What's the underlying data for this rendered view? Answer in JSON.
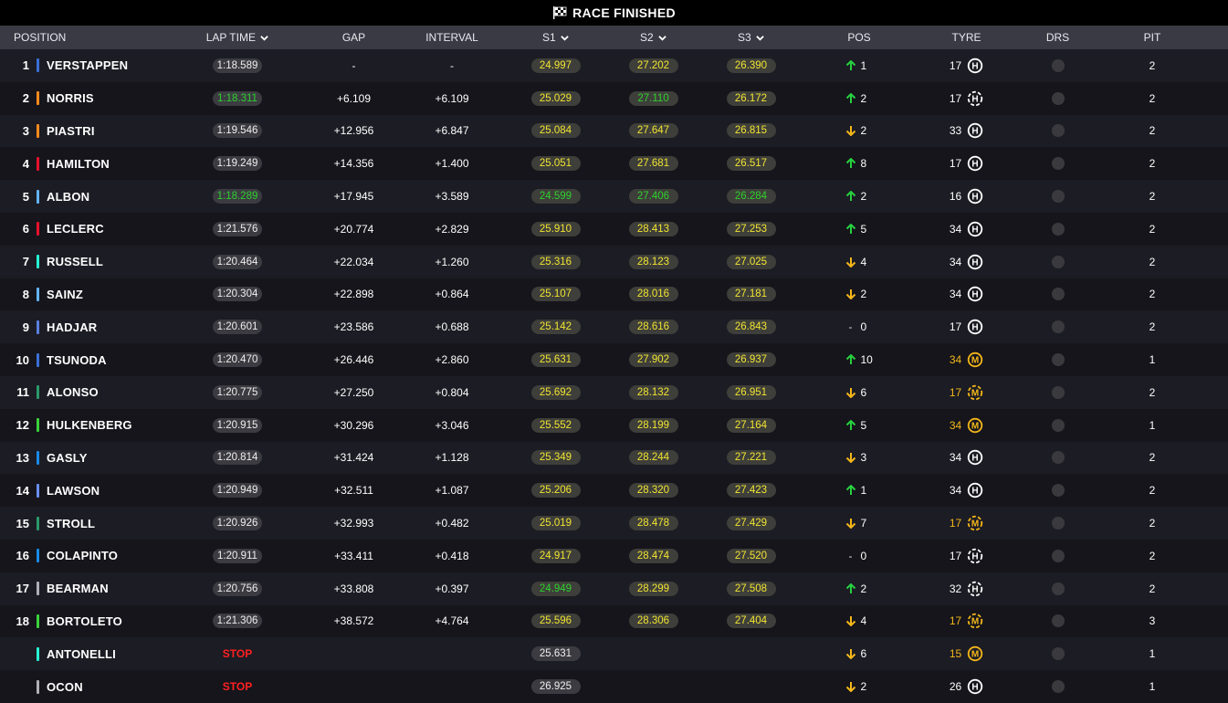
{
  "title": "RACE FINISHED",
  "flag_icon": "chequered-flag-icon",
  "colors": {
    "green": "#2ed22e",
    "sector_yellow": "#f1e531",
    "stop_red": "#ff2020",
    "up_green": "#27d13f",
    "down_amber": "#f4b71a"
  },
  "headers": {
    "position": "POSITION",
    "lap_time": "LAP TIME",
    "gap": "GAP",
    "interval": "INTERVAL",
    "s1": "S1",
    "s2": "S2",
    "s3": "S3",
    "pos": "POS",
    "tyre": "TYRE",
    "drs": "DRS",
    "pit": "PIT"
  },
  "rows": [
    {
      "pos": "1",
      "name": "VERSTAPPEN",
      "team_color": "#3a6fd8",
      "lap": "1:18.589",
      "lap_green": false,
      "gap": "-",
      "interval": "-",
      "s1": "24.997",
      "s1c": "y",
      "s2": "27.202",
      "s2c": "y",
      "s3": "26.390",
      "s3c": "y",
      "dir": "up",
      "change": "1",
      "tyre_age": "17",
      "tyre": "H",
      "tyre_yellow": false,
      "pit": "2"
    },
    {
      "pos": "2",
      "name": "NORRIS",
      "team_color": "#ff8a1c",
      "lap": "1:18.311",
      "lap_green": true,
      "gap": "+6.109",
      "interval": "+6.109",
      "s1": "25.029",
      "s1c": "y",
      "s2": "27.110",
      "s2c": "g",
      "s3": "26.172",
      "s3c": "y",
      "dir": "up",
      "change": "2",
      "tyre_age": "17",
      "tyre": "H",
      "tyre_yellow": false,
      "tyre_dashed": true,
      "pit": "2"
    },
    {
      "pos": "3",
      "name": "PIASTRI",
      "team_color": "#ff8a1c",
      "lap": "1:19.546",
      "lap_green": false,
      "gap": "+12.956",
      "interval": "+6.847",
      "s1": "25.084",
      "s1c": "y",
      "s2": "27.647",
      "s2c": "y",
      "s3": "26.815",
      "s3c": "y",
      "dir": "down",
      "change": "2",
      "tyre_age": "33",
      "tyre": "H",
      "tyre_yellow": false,
      "pit": "2"
    },
    {
      "pos": "4",
      "name": "HAMILTON",
      "team_color": "#e8102d",
      "lap": "1:19.249",
      "lap_green": false,
      "gap": "+14.356",
      "interval": "+1.400",
      "s1": "25.051",
      "s1c": "y",
      "s2": "27.681",
      "s2c": "y",
      "s3": "26.517",
      "s3c": "y",
      "dir": "up",
      "change": "8",
      "tyre_age": "17",
      "tyre": "H",
      "tyre_yellow": false,
      "pit": "2"
    },
    {
      "pos": "5",
      "name": "ALBON",
      "team_color": "#64b4ff",
      "lap": "1:18.289",
      "lap_green": true,
      "gap": "+17.945",
      "interval": "+3.589",
      "s1": "24.599",
      "s1c": "g",
      "s2": "27.406",
      "s2c": "g",
      "s3": "26.284",
      "s3c": "g",
      "dir": "up",
      "change": "2",
      "tyre_age": "16",
      "tyre": "H",
      "tyre_yellow": false,
      "pit": "2"
    },
    {
      "pos": "6",
      "name": "LECLERC",
      "team_color": "#e8102d",
      "lap": "1:21.576",
      "lap_green": false,
      "gap": "+20.774",
      "interval": "+2.829",
      "s1": "25.910",
      "s1c": "y",
      "s2": "28.413",
      "s2c": "y",
      "s3": "27.253",
      "s3c": "y",
      "dir": "up",
      "change": "5",
      "tyre_age": "34",
      "tyre": "H",
      "tyre_yellow": false,
      "pit": "2"
    },
    {
      "pos": "7",
      "name": "RUSSELL",
      "team_color": "#27f4d2",
      "lap": "1:20.464",
      "lap_green": false,
      "gap": "+22.034",
      "interval": "+1.260",
      "s1": "25.316",
      "s1c": "y",
      "s2": "28.123",
      "s2c": "y",
      "s3": "27.025",
      "s3c": "y",
      "dir": "down",
      "change": "4",
      "tyre_age": "34",
      "tyre": "H",
      "tyre_yellow": false,
      "pit": "2"
    },
    {
      "pos": "8",
      "name": "SAINZ",
      "team_color": "#64b4ff",
      "lap": "1:20.304",
      "lap_green": false,
      "gap": "+22.898",
      "interval": "+0.864",
      "s1": "25.107",
      "s1c": "y",
      "s2": "28.016",
      "s2c": "y",
      "s3": "27.181",
      "s3c": "y",
      "dir": "down",
      "change": "2",
      "tyre_age": "34",
      "tyre": "H",
      "tyre_yellow": false,
      "pit": "2"
    },
    {
      "pos": "9",
      "name": "HADJAR",
      "team_color": "#5a7fe0",
      "lap": "1:20.601",
      "lap_green": false,
      "gap": "+23.586",
      "interval": "+0.688",
      "s1": "25.142",
      "s1c": "y",
      "s2": "28.616",
      "s2c": "y",
      "s3": "26.843",
      "s3c": "y",
      "dir": "same",
      "change": "0",
      "tyre_age": "17",
      "tyre": "H",
      "tyre_yellow": false,
      "pit": "2"
    },
    {
      "pos": "10",
      "name": "TSUNODA",
      "team_color": "#3a6fd8",
      "lap": "1:20.470",
      "lap_green": false,
      "gap": "+26.446",
      "interval": "+2.860",
      "s1": "25.631",
      "s1c": "y",
      "s2": "27.902",
      "s2c": "y",
      "s3": "26.937",
      "s3c": "y",
      "dir": "up",
      "change": "10",
      "tyre_age": "34",
      "tyre": "M",
      "tyre_yellow": true,
      "pit": "1"
    },
    {
      "pos": "11",
      "name": "ALONSO",
      "team_color": "#2a9a6a",
      "lap": "1:20.775",
      "lap_green": false,
      "gap": "+27.250",
      "interval": "+0.804",
      "s1": "25.692",
      "s1c": "y",
      "s2": "28.132",
      "s2c": "y",
      "s3": "26.951",
      "s3c": "y",
      "dir": "down",
      "change": "6",
      "tyre_age": "17",
      "tyre": "M",
      "tyre_yellow": true,
      "tyre_dashed": true,
      "pit": "2"
    },
    {
      "pos": "12",
      "name": "HULKENBERG",
      "team_color": "#3ad33a",
      "lap": "1:20.915",
      "lap_green": false,
      "gap": "+30.296",
      "interval": "+3.046",
      "s1": "25.552",
      "s1c": "y",
      "s2": "28.199",
      "s2c": "y",
      "s3": "27.164",
      "s3c": "y",
      "dir": "up",
      "change": "5",
      "tyre_age": "34",
      "tyre": "M",
      "tyre_yellow": true,
      "pit": "1"
    },
    {
      "pos": "13",
      "name": "GASLY",
      "team_color": "#1a8ae8",
      "lap": "1:20.814",
      "lap_green": false,
      "gap": "+31.424",
      "interval": "+1.128",
      "s1": "25.349",
      "s1c": "y",
      "s2": "28.244",
      "s2c": "y",
      "s3": "27.221",
      "s3c": "y",
      "dir": "down",
      "change": "3",
      "tyre_age": "34",
      "tyre": "H",
      "tyre_yellow": false,
      "pit": "2"
    },
    {
      "pos": "14",
      "name": "LAWSON",
      "team_color": "#6a8ff0",
      "lap": "1:20.949",
      "lap_green": false,
      "gap": "+32.511",
      "interval": "+1.087",
      "s1": "25.206",
      "s1c": "y",
      "s2": "28.320",
      "s2c": "y",
      "s3": "27.423",
      "s3c": "y",
      "dir": "up",
      "change": "1",
      "tyre_age": "34",
      "tyre": "H",
      "tyre_yellow": false,
      "pit": "2"
    },
    {
      "pos": "15",
      "name": "STROLL",
      "team_color": "#2a9a6a",
      "lap": "1:20.926",
      "lap_green": false,
      "gap": "+32.993",
      "interval": "+0.482",
      "s1": "25.019",
      "s1c": "y",
      "s2": "28.478",
      "s2c": "y",
      "s3": "27.429",
      "s3c": "y",
      "dir": "down",
      "change": "7",
      "tyre_age": "17",
      "tyre": "M",
      "tyre_yellow": true,
      "tyre_dashed": true,
      "pit": "2"
    },
    {
      "pos": "16",
      "name": "COLAPINTO",
      "team_color": "#1a8ae8",
      "lap": "1:20.911",
      "lap_green": false,
      "gap": "+33.411",
      "interval": "+0.418",
      "s1": "24.917",
      "s1c": "y",
      "s2": "28.474",
      "s2c": "y",
      "s3": "27.520",
      "s3c": "y",
      "dir": "same",
      "change": "0",
      "tyre_age": "17",
      "tyre": "H",
      "tyre_yellow": false,
      "tyre_dashed": true,
      "pit": "2"
    },
    {
      "pos": "17",
      "name": "BEARMAN",
      "team_color": "#b0b0b8",
      "lap": "1:20.756",
      "lap_green": false,
      "gap": "+33.808",
      "interval": "+0.397",
      "s1": "24.949",
      "s1c": "g",
      "s2": "28.299",
      "s2c": "y",
      "s3": "27.508",
      "s3c": "y",
      "dir": "up",
      "change": "2",
      "tyre_age": "32",
      "tyre": "H",
      "tyre_yellow": false,
      "tyre_dashed": true,
      "pit": "2"
    },
    {
      "pos": "18",
      "name": "BORTOLETO",
      "team_color": "#3ad33a",
      "lap": "1:21.306",
      "lap_green": false,
      "gap": "+38.572",
      "interval": "+4.764",
      "s1": "25.596",
      "s1c": "y",
      "s2": "28.306",
      "s2c": "y",
      "s3": "27.404",
      "s3c": "y",
      "dir": "down",
      "change": "4",
      "tyre_age": "17",
      "tyre": "M",
      "tyre_yellow": true,
      "tyre_dashed": true,
      "pit": "3"
    },
    {
      "pos": "",
      "name": "ANTONELLI",
      "team_color": "#27f4d2",
      "lap": "STOP",
      "stop": true,
      "gap": "",
      "interval": "",
      "s1": "25.631",
      "s1c": "w",
      "s2": "",
      "s2c": "",
      "s3": "",
      "s3c": "",
      "dir": "down",
      "change": "6",
      "tyre_age": "15",
      "tyre": "M",
      "tyre_yellow": true,
      "pit": "1"
    },
    {
      "pos": "",
      "name": "OCON",
      "team_color": "#b0b0b8",
      "lap": "STOP",
      "stop": true,
      "gap": "",
      "interval": "",
      "s1": "26.925",
      "s1c": "w",
      "s2": "",
      "s2c": "",
      "s3": "",
      "s3c": "",
      "dir": "down",
      "change": "2",
      "tyre_age": "26",
      "tyre": "H",
      "tyre_yellow": false,
      "pit": "1"
    }
  ]
}
